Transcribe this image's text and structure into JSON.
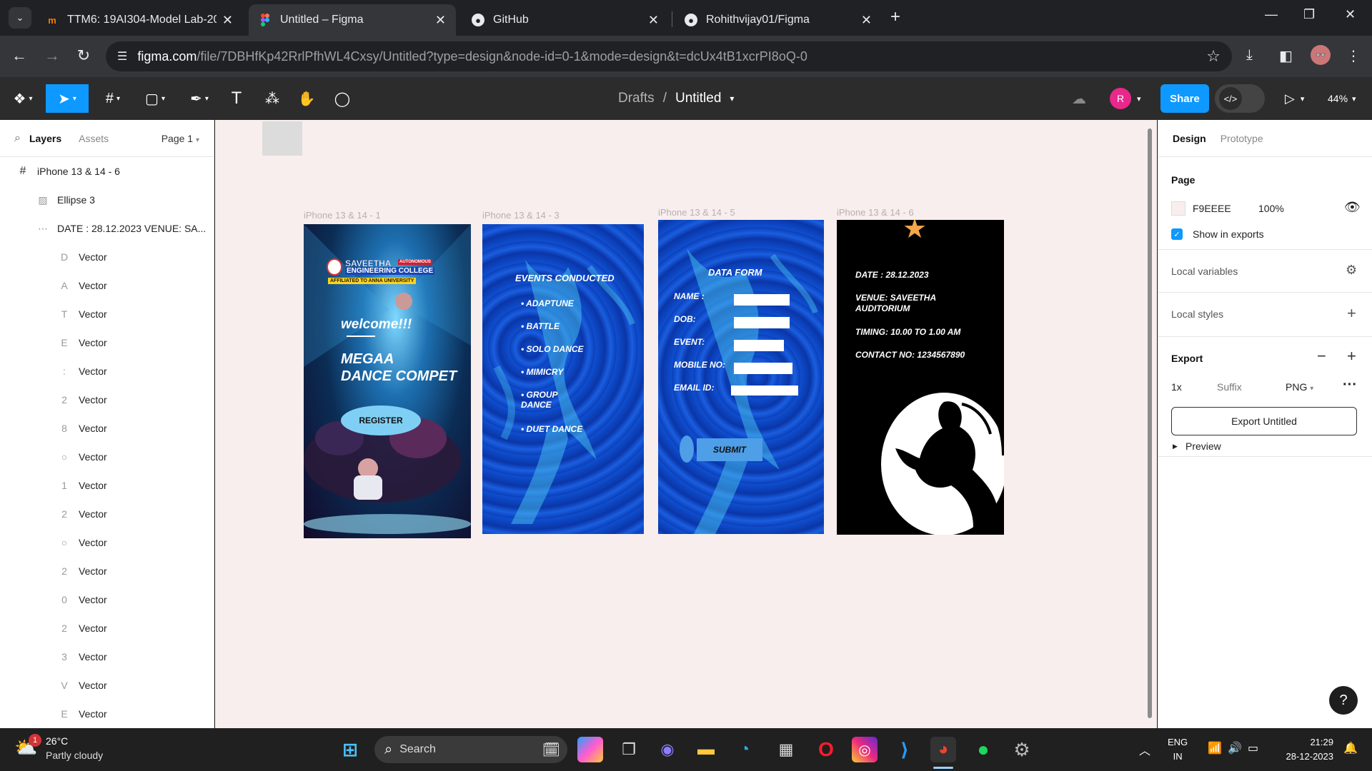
{
  "browser": {
    "tabs": [
      {
        "title": "TTM6: 19AI304-Model Lab-202",
        "favicon": "m",
        "active": false
      },
      {
        "title": "Untitled – Figma",
        "favicon": "figma",
        "active": true
      },
      {
        "title": "GitHub",
        "favicon": "github",
        "active": false
      },
      {
        "title": "Rohithvijay01/Figma",
        "favicon": "github",
        "active": false
      }
    ],
    "url_host": "figma.com",
    "url_path": "/file/7DBHfKp42RrlPfhWL4Cxsy/Untitled?type=design&node-id=0-1&mode=design&t=dcUx4tB1xcrPI8oQ-0"
  },
  "figma": {
    "breadcrumb_parent": "Drafts",
    "breadcrumb_sep": "/",
    "file_name": "Untitled",
    "user_initial": "R",
    "share_label": "Share",
    "zoom": "44%"
  },
  "left_panel": {
    "tab_layers": "Layers",
    "tab_assets": "Assets",
    "page": "Page 1",
    "layers": [
      {
        "name": "iPhone 13 & 14 - 6",
        "icon": "frame-icon",
        "indent": 0
      },
      {
        "name": "Ellipse 3",
        "icon": "image-icon",
        "indent": 1
      },
      {
        "name": "DATE : 28.12.2023 VENUE: SA...",
        "icon": "text-frame-icon",
        "indent": 1
      },
      {
        "name": "Vector",
        "icon": "vector-icon",
        "indent": 2
      },
      {
        "name": "Vector",
        "icon": "vector-icon",
        "indent": 2
      },
      {
        "name": "Vector",
        "icon": "vector-icon",
        "indent": 2
      },
      {
        "name": "Vector",
        "icon": "vector-icon",
        "indent": 2
      },
      {
        "name": "Vector",
        "icon": "vector-icon",
        "indent": 2
      },
      {
        "name": "Vector",
        "icon": "vector-icon",
        "indent": 2
      },
      {
        "name": "Vector",
        "icon": "vector-icon",
        "indent": 2
      },
      {
        "name": "Vector",
        "icon": "ellipse-icon",
        "indent": 2
      },
      {
        "name": "Vector",
        "icon": "vector-icon",
        "indent": 2
      },
      {
        "name": "Vector",
        "icon": "vector-icon",
        "indent": 2
      },
      {
        "name": "Vector",
        "icon": "ellipse-icon",
        "indent": 2
      },
      {
        "name": "Vector",
        "icon": "vector-icon",
        "indent": 2
      },
      {
        "name": "Vector",
        "icon": "vector-icon",
        "indent": 2
      },
      {
        "name": "Vector",
        "icon": "vector-icon",
        "indent": 2
      },
      {
        "name": "Vector",
        "icon": "vector-icon",
        "indent": 2
      },
      {
        "name": "Vector",
        "icon": "vector-icon",
        "indent": 2
      },
      {
        "name": "Vector",
        "icon": "vector-icon",
        "indent": 2
      }
    ]
  },
  "canvas": {
    "background": "#F9EEEE",
    "frames": [
      {
        "label": "iPhone 13 & 14 - 1",
        "college_line1": "SAVEETHA",
        "college_badge": "AUTONOMOUS",
        "college_line2": "ENGINEERING COLLEGE",
        "college_line3": "AFFILIATED TO ANNA UNIVERSITY",
        "welcome": "welcome!!!",
        "title_line1": "MEGAA",
        "title_line2": "DANCE COMPET",
        "register": "REGISTER"
      },
      {
        "label": "iPhone 13 & 14 - 3",
        "heading": "EVENTS CONDUCTED",
        "events": [
          "ADAPTUNE",
          "BATTLE",
          "SOLO DANCE",
          "MIMICRY",
          "GROUP DANCE",
          "DUET DANCE"
        ]
      },
      {
        "label": "iPhone 13 & 14 - 5",
        "heading": "DATA FORM",
        "fields": [
          "NAME :",
          "DOB:",
          "EVENT:",
          "MOBILE NO:",
          "EMAIL ID:"
        ],
        "submit": "SUBMIT"
      },
      {
        "label": "iPhone 13 & 14 - 6",
        "date": "DATE  : 28.12.2023",
        "venue": "VENUE: SAVEETHA AUDITORIUM",
        "timing": "TIMING: 10.00 TO 1.00 AM",
        "contact": "CONTACT NO: 1234567890"
      }
    ]
  },
  "right_panel": {
    "tab_design": "Design",
    "tab_prototype": "Prototype",
    "page_heading": "Page",
    "page_color": "F9EEEE",
    "page_opacity": "100%",
    "show_in_exports": "Show in exports",
    "local_variables": "Local variables",
    "local_styles": "Local styles",
    "export_heading": "Export",
    "export_scale": "1x",
    "export_suffix_placeholder": "Suffix",
    "export_format": "PNG",
    "export_button": "Export Untitled",
    "preview": "Preview"
  },
  "taskbar": {
    "weather_temp": "26°C",
    "weather_desc": "Partly cloudy",
    "weather_badge": "1",
    "search_placeholder": "Search",
    "lang_line1": "ENG",
    "lang_line2": "IN",
    "time": "21:29",
    "date": "28-12-2023"
  },
  "colors": {
    "figma_blue": "#0D99FF",
    "frame_blue": "#0b3fb8",
    "frame_black": "#000000",
    "star": "#F3A64A"
  }
}
